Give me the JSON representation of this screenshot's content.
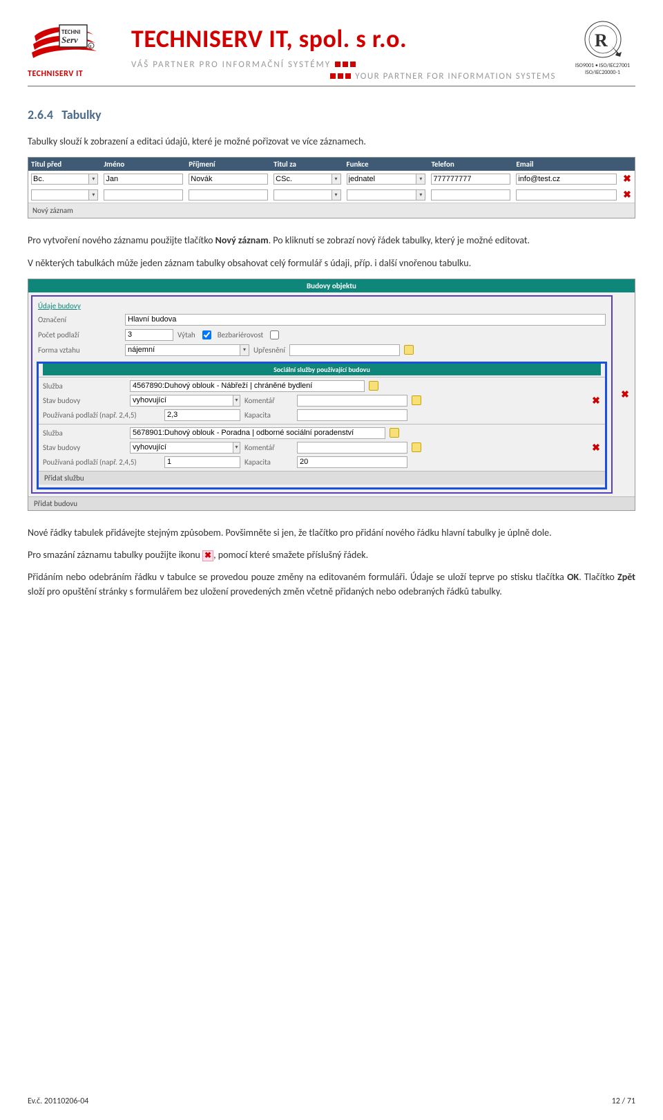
{
  "header": {
    "company_bold": "TECHNISERV IT,",
    "company_light": " spol. s r.o.",
    "logo_label": "TECHNISERV IT",
    "tagline_cz": "VÁŠ PARTNER PRO INFORMAČNÍ SYSTÉMY",
    "tagline_en": "YOUR PARTNER FOR INFORMATION SYSTEMS",
    "cert_line1": "ISO9001 • ISO/IEC27001",
    "cert_line2": "ISO/IEC20000-1"
  },
  "section": {
    "number": "2.6.4",
    "title": "Tabulky"
  },
  "body": {
    "p1": "Tabulky slouží k zobrazení a editaci údajů, které je možné pořizovat ve více záznamech.",
    "p2a": "Pro vytvoření nového záznamu použijte tlačítko ",
    "p2b": "Nový záznam",
    "p2c": ". Po kliknutí se zobrazí nový řádek tabulky, který je možné editovat.",
    "p3": "V některých tabulkách může jeden záznam tabulky obsahovat celý formulář s údaji, příp. i další vnořenou tabulku.",
    "p4": "Nové řádky tabulek přidávejte stejným způsobem. Povšimněte si jen, že tlačítko pro přidání nového řádku hlavní tabulky je úplně dole.",
    "p5a": "Pro smazání záznamu tabulky použijte ikonu ",
    "p5b": ", pomocí které smažete příslušný řádek.",
    "p6a": "Přidáním nebo odebráním řádku v tabulce se provedou pouze změny na editovaném formuláři. Údaje se uloží teprve po stisku tlačítka ",
    "p6b": "OK",
    "p6c": ". Tlačítko ",
    "p6d": "Zpět",
    "p6e": " složí pro opuštění stránky s formulářem bez uložení provedených změn včetně přidaných nebo odebraných řádků tabulky."
  },
  "table1": {
    "headers": [
      "Titul před",
      "Jméno",
      "Příjmení",
      "Titul za",
      "Funkce",
      "Telefon",
      "Email"
    ],
    "row1": {
      "titul_pred": "Bc.",
      "jmeno": "Jan",
      "prijmeni": "Novák",
      "titul_za": "CSc.",
      "funkce": "jednatel",
      "telefon": "777777777",
      "email": "info@test.cz"
    },
    "footer": "Nový záznam"
  },
  "form2": {
    "title_main": "Budovy objektu",
    "link_udaje": "Údaje budovy",
    "lbl_oznaceni": "Označení",
    "val_oznaceni": "Hlavní budova",
    "lbl_pocet": "Počet podlaží",
    "val_pocet": "3",
    "lbl_vytah": "Výtah",
    "lbl_bezbar": "Bezbariérovost",
    "lbl_forma": "Forma vztahu",
    "val_forma": "nájemní",
    "lbl_upresneni": "Upřesnění",
    "title_sub": "Sociální služby používající budovu",
    "lbl_sluzba": "Služba",
    "lbl_stav": "Stav budovy",
    "lbl_komentar": "Komentář",
    "lbl_podlazi": "Používaná podlaží (např. 2,4,5)",
    "lbl_kapacita": "Kapacita",
    "svc1": {
      "sluzba": "4567890:Duhový oblouk - Nábřeží | chráněné bydlení",
      "stav": "vyhovující",
      "podlazi": "2,3",
      "kapacita": ""
    },
    "svc2": {
      "sluzba": "5678901:Duhový oblouk - Poradna | odborné sociální poradenství",
      "stav": "vyhovující",
      "podlazi": "1",
      "kapacita": "20"
    },
    "add_sluzba": "Přidat službu",
    "add_budova": "Přidat budovu"
  },
  "footer": {
    "left": "Ev.č. 20110206-04",
    "right": "12 / 71"
  }
}
